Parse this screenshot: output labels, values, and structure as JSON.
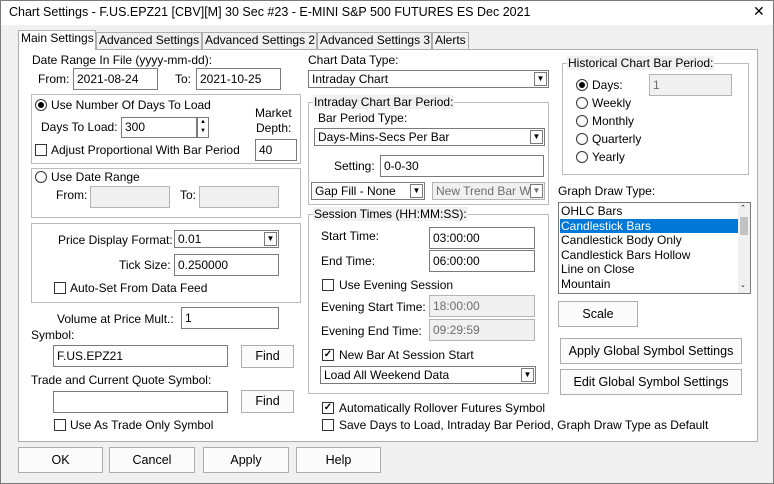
{
  "window": {
    "title": "Chart Settings - F.US.EPZ21 [CBV][M]  30 Sec   #23 - E-MINI S&P 500 FUTURES ES Dec 2021",
    "close": "✕"
  },
  "tabs": [
    "Main Settings",
    "Advanced Settings",
    "Advanced Settings 2",
    "Advanced Settings 3",
    "Alerts"
  ],
  "left": {
    "date_range_label": "Date Range In File (yyyy-mm-dd):",
    "from_label": "From:",
    "from_value": "2021-08-24",
    "to_label": "To:",
    "to_value": "2021-10-25",
    "use_days_label": "Use Number Of Days To Load",
    "days_to_load_label": "Days To Load:",
    "days_to_load_value": "300",
    "market_depth_label_1": "Market",
    "market_depth_label_2": "Depth:",
    "market_depth_value": "40",
    "adjust_label": "Adjust Proportional With Bar Period",
    "use_date_range_label": "Use Date Range",
    "dr_from_label": "From:",
    "dr_to_label": "To:",
    "price_format_label": "Price Display Format:",
    "price_format_value": "0.01",
    "tick_size_label": "Tick Size:",
    "tick_size_value": "0.250000",
    "auto_set_label": "Auto-Set From Data Feed",
    "vap_label": "Volume at Price Mult.:",
    "vap_value": "1",
    "symbol_label": "Symbol:",
    "symbol_value": "F.US.EPZ21",
    "find1": "Find",
    "trade_symbol_label": "Trade and Current Quote Symbol:",
    "trade_symbol_value": "",
    "find2": "Find",
    "trade_only_label": "Use As Trade Only Symbol"
  },
  "middle": {
    "chart_type_label": "Chart Data Type:",
    "chart_type_value": "Intraday Chart",
    "intraday_group": "Intraday Chart Bar Period:",
    "bar_period_type_label": "Bar Period Type:",
    "bar_period_type_value": "Days-Mins-Secs Per Bar",
    "setting_label": "Setting:",
    "setting_value": "0-0-30",
    "gap_fill_value": "Gap Fill - None",
    "new_trend_value": "New Trend Bar Wi",
    "session_group": "Session Times (HH:MM:SS):",
    "start_label": "Start Time:",
    "start_value": "03:00:00",
    "end_label": "End Time:",
    "end_value": "06:00:00",
    "use_evening_label": "Use Evening Session",
    "eve_start_label": "Evening Start Time:",
    "eve_start_value": "18:00:00",
    "eve_end_label": "Evening End Time:",
    "eve_end_value": "09:29:59",
    "new_bar_label": "New Bar At Session Start",
    "weekend_value": "Load All Weekend Data",
    "auto_rollover_label": "Automatically Rollover Futures Symbol",
    "save_default_label": "Save Days to Load, Intraday Bar Period, Graph Draw Type as Default"
  },
  "right": {
    "hist_group": "Historical Chart Bar Period:",
    "hist_options": [
      "Days:",
      "Weekly",
      "Monthly",
      "Quarterly",
      "Yearly"
    ],
    "days_value": "1",
    "graph_draw_label": "Graph Draw Type:",
    "graph_draw_items": [
      "OHLC Bars",
      "Candlestick Bars",
      "Candlestick Body Only",
      "Candlestick Bars Hollow",
      "Line on Close",
      "Mountain"
    ],
    "scale_button": "Scale",
    "apply_global": "Apply Global Symbol Settings",
    "edit_global": "Edit Global Symbol Settings"
  },
  "footer": {
    "ok": "OK",
    "cancel": "Cancel",
    "apply": "Apply",
    "help": "Help"
  }
}
